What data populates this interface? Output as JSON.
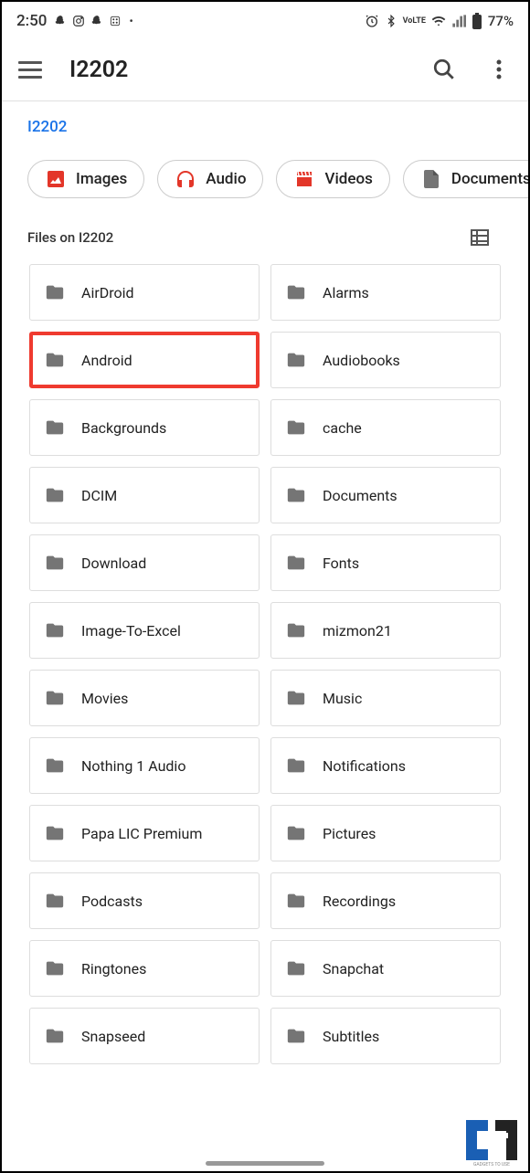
{
  "status": {
    "time": "2:50",
    "battery": "77%"
  },
  "appbar": {
    "title": "I2202"
  },
  "breadcrumb": "I2202",
  "chips": [
    {
      "label": "Images",
      "icon": "image"
    },
    {
      "label": "Audio",
      "icon": "audio"
    },
    {
      "label": "Videos",
      "icon": "video"
    },
    {
      "label": "Documents",
      "icon": "document"
    }
  ],
  "section": {
    "title": "Files on I2202"
  },
  "folders": [
    {
      "name": "AirDroid"
    },
    {
      "name": "Alarms"
    },
    {
      "name": "Android",
      "highlighted": true
    },
    {
      "name": "Audiobooks"
    },
    {
      "name": "Backgrounds"
    },
    {
      "name": "cache"
    },
    {
      "name": "DCIM"
    },
    {
      "name": "Documents"
    },
    {
      "name": "Download"
    },
    {
      "name": "Fonts"
    },
    {
      "name": "Image-To-Excel"
    },
    {
      "name": "mizmon21"
    },
    {
      "name": "Movies"
    },
    {
      "name": "Music"
    },
    {
      "name": "Nothing 1 Audio"
    },
    {
      "name": "Notifications"
    },
    {
      "name": "Papa LIC Premium"
    },
    {
      "name": "Pictures"
    },
    {
      "name": "Podcasts"
    },
    {
      "name": "Recordings"
    },
    {
      "name": "Ringtones"
    },
    {
      "name": "Snapchat"
    },
    {
      "name": "Snapseed"
    },
    {
      "name": "Subtitles"
    }
  ],
  "watermark": "GADGETS TO USE"
}
